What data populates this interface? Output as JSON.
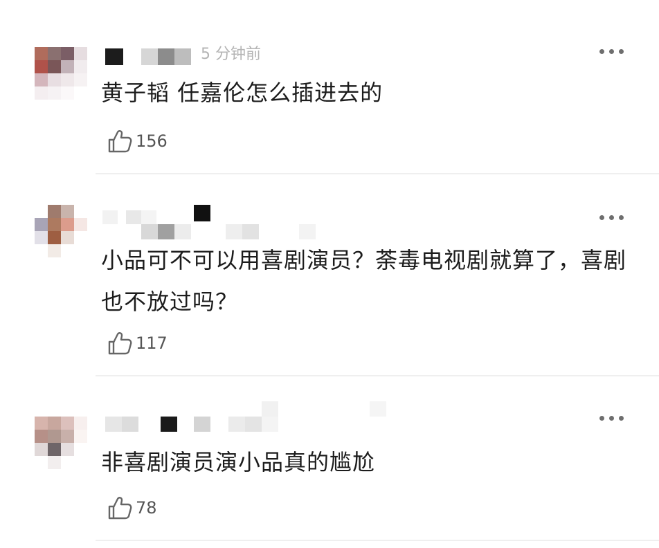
{
  "comments": [
    {
      "time": "5 分钟前",
      "text": "黄子韬 任嘉伦怎么插进去的",
      "likes": "156",
      "avatar_colors": [
        "#b06c5c",
        "#8a7070",
        "#7b5e66",
        "#e6dde0",
        "#b0524a",
        "#7a5658",
        "#c2b2b8",
        "#f1ecee",
        "#d4b6bc",
        "#e8dee2",
        "#efe8ea",
        "#f6f2f3",
        "#f4eef0",
        "#f6f2f4",
        "#fbf8f9",
        "#ffffff"
      ]
    },
    {
      "time": "",
      "text": "小品可不可以用喜剧演员？荼毒电视剧就算了，喜剧也不放过吗？",
      "likes": "117",
      "avatar_colors": [
        "#ffffff",
        "#9f7b6d",
        "#c9b4ac",
        "#ffffff",
        "#a8a4b6",
        "#ad7a60",
        "#dc9c8c",
        "#f5e7e4",
        "#e2e0e8",
        "#9e5e42",
        "#e8dcd6",
        "#ffffff",
        "#ffffff",
        "#f2ebe6",
        "#ffffff",
        "#ffffff"
      ]
    },
    {
      "time": "",
      "text": "非喜剧演员演小品真的尴尬",
      "likes": "78",
      "avatar_colors": [
        "#d7b4ac",
        "#c8a79e",
        "#dcc0bc",
        "#f7efee",
        "#b69088",
        "#b09890",
        "#c8b0aa",
        "#faf4f2",
        "#e0d8d8",
        "#6e6568",
        "#e6dfe0",
        "#ffffff",
        "#ffffff",
        "#f2eeee",
        "#ffffff",
        "#ffffff"
      ]
    }
  ]
}
